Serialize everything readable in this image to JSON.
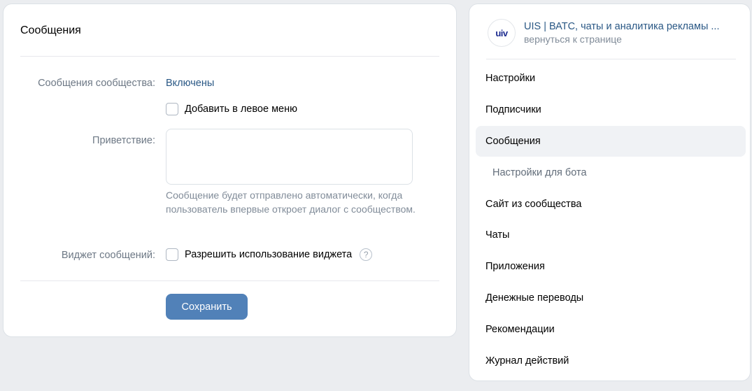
{
  "main": {
    "title": "Сообщения",
    "community_messages_label": "Сообщения сообщества:",
    "community_messages_value": "Включены",
    "add_to_left_menu_label": "Добавить в левое меню",
    "greeting_label": "Приветствие:",
    "greeting_value": "",
    "greeting_hint": "Сообщение будет отправлено автоматически, когда пользователь впервые откроет диалог с сообществом.",
    "widget_label": "Виджет сообщений:",
    "widget_checkbox_label": "Разрешить использование виджета",
    "help_icon_glyph": "?",
    "save_label": "Сохранить"
  },
  "sidebar": {
    "group_name": "UIS | ВАТС, чаты и аналитика рекламы ...",
    "group_back": "вернуться к странице",
    "avatar_text": "uiv",
    "items": [
      {
        "label": "Настройки"
      },
      {
        "label": "Подписчики"
      },
      {
        "label": "Сообщения"
      },
      {
        "label": "Настройки для бота"
      },
      {
        "label": "Сайт из сообщества"
      },
      {
        "label": "Чаты"
      },
      {
        "label": "Приложения"
      },
      {
        "label": "Денежные переводы"
      },
      {
        "label": "Рекомендации"
      },
      {
        "label": "Журнал действий"
      }
    ]
  },
  "colors": {
    "accent": "#5181b8",
    "link": "#2a5885",
    "page_bg": "#ebedf0",
    "active_item_bg": "#f0f2f5"
  },
  "icons": {
    "help": "question-circle-icon",
    "checkbox": "checkbox-unchecked-icon"
  }
}
